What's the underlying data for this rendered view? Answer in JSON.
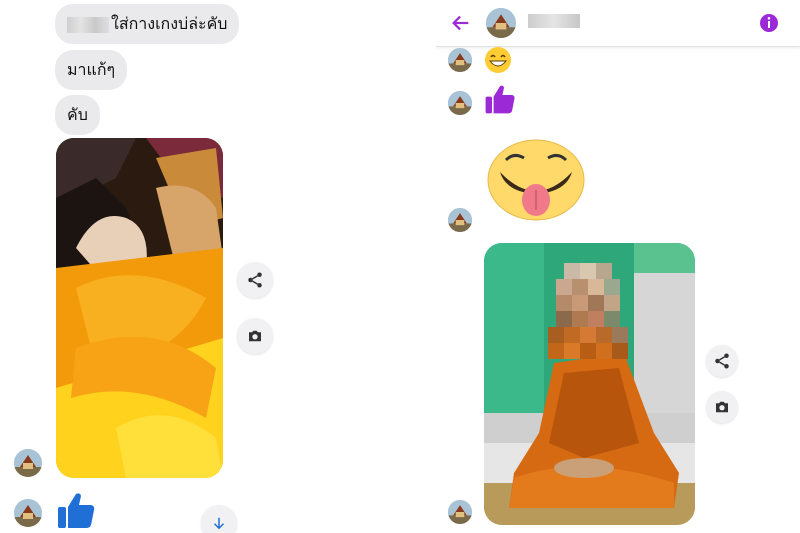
{
  "colors": {
    "bubble_bg": "#eaeaed",
    "messenger_purple": "#9b2ad6",
    "like_blue": "#1f6fd6",
    "robe_orange": "#f4a11c"
  },
  "left_chat": {
    "messages": [
      {
        "text": "ใส่กางเกงบ่ล่ะคับ",
        "redacted_prefix": true
      },
      {
        "text": "มาแก้ๆ"
      },
      {
        "text": "คับ"
      }
    ],
    "photo_icon": "photo-bedroom-orange-robe",
    "actions": [
      "share-icon",
      "camera-icon"
    ],
    "reaction_icon": "thumbs-up-icon",
    "scroll_icon": "arrow-down-icon"
  },
  "right_chat": {
    "header": {
      "back_icon": "back-arrow-icon",
      "info_icon": "info-icon",
      "name_redacted": true
    },
    "messages": [
      {
        "type": "emoji",
        "icon": "grinning-emoji-icon"
      },
      {
        "type": "emoji",
        "icon": "thumbs-up-icon"
      },
      {
        "type": "sticker",
        "icon": "tongue-out-sticker-icon"
      },
      {
        "type": "photo",
        "icon": "photo-seated-monk-pixelated"
      }
    ],
    "actions": [
      "share-icon",
      "camera-icon"
    ]
  }
}
